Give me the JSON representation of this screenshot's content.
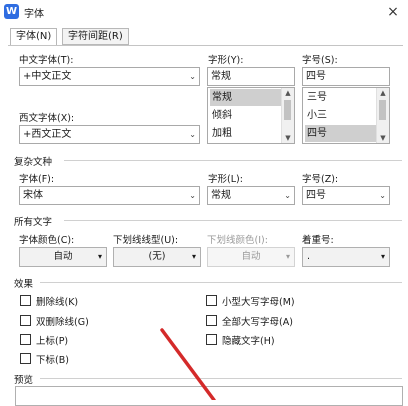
{
  "window": {
    "title": "字体",
    "close_glyph": "×",
    "app_icon_glyph": "W"
  },
  "tabs": [
    {
      "label": "字体(N)"
    },
    {
      "label": "字符间距(R)"
    }
  ],
  "chinese_font": {
    "label": "中文字体(T):",
    "value": "+中文正文"
  },
  "font_style": {
    "label": "字形(Y):",
    "value": "常规",
    "options": [
      "常规",
      "倾斜",
      "加粗"
    ],
    "selected_index": 0
  },
  "font_size": {
    "label": "字号(S):",
    "value": "四号",
    "options": [
      "三号",
      "小三",
      "四号"
    ],
    "selected_index": 2
  },
  "western_font": {
    "label": "西文字体(X):",
    "value": "+西文正文"
  },
  "complex": {
    "group_label": "复杂文种",
    "font": {
      "label": "字体(F):",
      "value": "宋体"
    },
    "style": {
      "label": "字形(L):",
      "value": "常规"
    },
    "size": {
      "label": "字号(Z):",
      "value": "四号"
    }
  },
  "all_text": {
    "group_label": "所有文字",
    "font_color": {
      "label": "字体颜色(C):",
      "value": "自动"
    },
    "underline_style": {
      "label": "下划线线型(U):",
      "value": "(无)"
    },
    "underline_color": {
      "label": "下划线颜色(I):",
      "value": "自动"
    },
    "emphasis": {
      "label": "着重号:",
      "value": "."
    }
  },
  "effects": {
    "group_label": "效果",
    "left": [
      {
        "label": "删除线(K)",
        "checked": false
      },
      {
        "label": "双删除线(G)",
        "checked": false
      },
      {
        "label": "上标(P)",
        "checked": false
      },
      {
        "label": "下标(B)",
        "checked": false
      }
    ],
    "right": [
      {
        "label": "小型大写字母(M)",
        "checked": false
      },
      {
        "label": "全部大写字母(A)",
        "checked": false
      },
      {
        "label": "隐藏文字(H)",
        "checked": false
      }
    ]
  },
  "preview": {
    "group_label": "预览"
  },
  "icons": {
    "dropdown_arrow": "▾",
    "combo_arrow": "⌄",
    "scroll_up": "▲",
    "scroll_down": "▼"
  },
  "colors": {
    "app_icon": "#2f6de1",
    "selection": "#cfcfcf",
    "annotation_arrow": "#d42a2a"
  }
}
